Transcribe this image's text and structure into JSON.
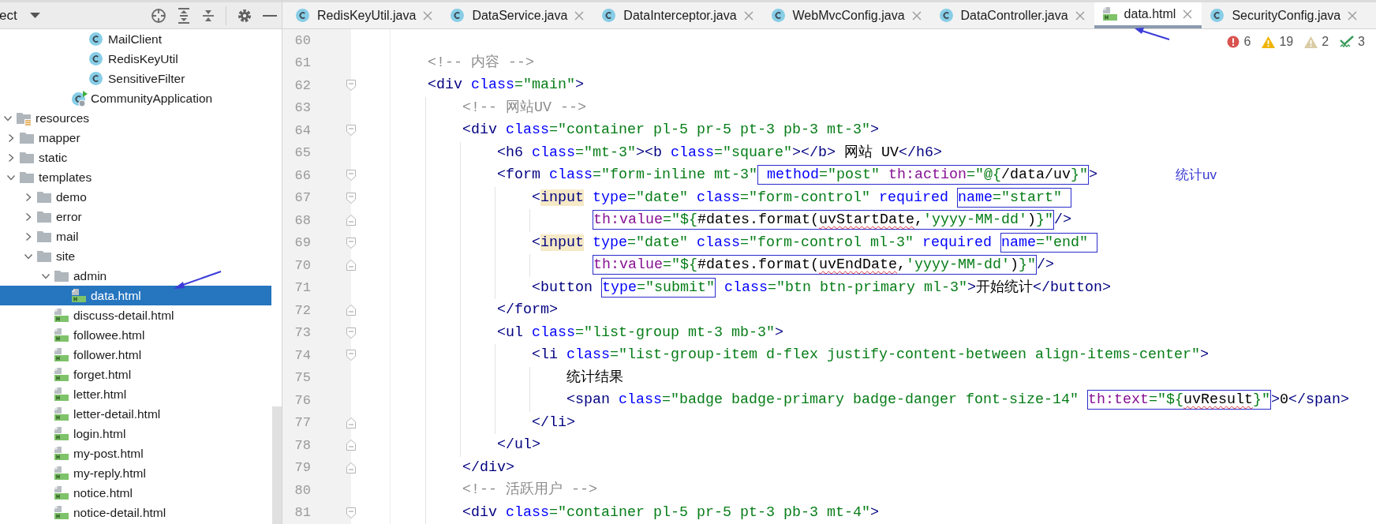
{
  "project_panel": {
    "title": "ect",
    "tree": [
      {
        "children": [
          {
            "children": [
              {
                "children": [
                  {
                    "children": [
                      {
                        "children": [
                          {
                            "label": "MailClient",
                            "kind": "class",
                            "selected": false
                          },
                          {
                            "label": "RedisKeyUtil",
                            "kind": "class",
                            "selected": false
                          },
                          {
                            "label": "SensitiveFilter",
                            "kind": "class",
                            "selected": false
                          }
                        ]
                      },
                      {
                        "label": "CommunityApplication",
                        "kind": "app",
                        "selected": false
                      }
                    ]
                  }
                ]
              }
            ]
          }
        ]
      },
      {
        "label": "resources",
        "kind": "resources",
        "expanded": true,
        "selected": false,
        "children": [
          {
            "label": "mapper",
            "kind": "folder",
            "expanded": false,
            "selected": false
          },
          {
            "label": "static",
            "kind": "folder",
            "expanded": false,
            "selected": false
          },
          {
            "label": "templates",
            "kind": "folder",
            "expanded": true,
            "selected": false,
            "children": [
              {
                "label": "demo",
                "kind": "folder",
                "expanded": false,
                "selected": false
              },
              {
                "label": "error",
                "kind": "folder",
                "expanded": false,
                "selected": false
              },
              {
                "label": "mail",
                "kind": "folder",
                "expanded": false,
                "selected": false
              },
              {
                "label": "site",
                "kind": "folder",
                "expanded": true,
                "selected": false,
                "children": [
                  {
                    "label": "admin",
                    "kind": "folder",
                    "expanded": true,
                    "selected": false,
                    "children": [
                      {
                        "label": "data.html",
                        "kind": "html",
                        "selected": true
                      }
                    ]
                  },
                  {
                    "label": "discuss-detail.html",
                    "kind": "html",
                    "selected": false
                  },
                  {
                    "label": "followee.html",
                    "kind": "html",
                    "selected": false
                  },
                  {
                    "label": "follower.html",
                    "kind": "html",
                    "selected": false
                  },
                  {
                    "label": "forget.html",
                    "kind": "html",
                    "selected": false
                  },
                  {
                    "label": "letter.html",
                    "kind": "html",
                    "selected": false
                  },
                  {
                    "label": "letter-detail.html",
                    "kind": "html",
                    "selected": false
                  },
                  {
                    "label": "login.html",
                    "kind": "html",
                    "selected": false
                  },
                  {
                    "label": "my-post.html",
                    "kind": "html",
                    "selected": false
                  },
                  {
                    "label": "my-reply.html",
                    "kind": "html",
                    "selected": false
                  },
                  {
                    "label": "notice.html",
                    "kind": "html",
                    "selected": false
                  },
                  {
                    "label": "notice-detail.html",
                    "kind": "html",
                    "selected": false
                  }
                ]
              }
            ]
          }
        ]
      }
    ]
  },
  "editor": {
    "tabs": [
      {
        "label": "RedisKeyUtil.java",
        "kind": "class",
        "selected": false
      },
      {
        "label": "DataService.java",
        "kind": "class",
        "selected": false
      },
      {
        "label": "DataInterceptor.java",
        "kind": "class",
        "selected": false
      },
      {
        "label": "WebMvcConfig.java",
        "kind": "class",
        "selected": false
      },
      {
        "label": "DataController.java",
        "kind": "class",
        "selected": false
      },
      {
        "label": "data.html",
        "kind": "html",
        "selected": true
      },
      {
        "label": "SecurityConfig.java",
        "kind": "class",
        "selected": false
      }
    ],
    "inspections": [
      {
        "kind": "error",
        "count": "6"
      },
      {
        "kind": "warning",
        "count": "19"
      },
      {
        "kind": "weak-warning",
        "count": "2"
      },
      {
        "kind": "typo",
        "count": "3"
      }
    ],
    "lines": [
      {
        "number": "60",
        "fold_start": false,
        "fold_end": false
      },
      {
        "number": "61",
        "fold_start": false,
        "fold_end": false,
        "continuation": false,
        "segments": [
          {
            "kind": "plain",
            "tokens": [
              {
                "kind": "comment",
                "text": "<!-- 内容 -->"
              }
            ]
          }
        ]
      },
      {
        "number": "62",
        "fold_start": true,
        "fold_end": false,
        "continuation": false,
        "segments": [
          {
            "kind": "plain",
            "tokens": [
              {
                "kind": "tag",
                "text": "<div"
              },
              {
                "kind": "attr",
                "text": " class"
              },
              {
                "kind": "value",
                "text": "=\"main\""
              },
              {
                "kind": "tag",
                "text": ">"
              }
            ]
          }
        ],
        "children": [
          {
            "number": "63",
            "fold_start": false,
            "fold_end": false,
            "continuation": false,
            "segments": [
              {
                "kind": "plain",
                "tokens": [
                  {
                    "kind": "comment",
                    "text": "<!-- 网站UV -->"
                  }
                ]
              }
            ]
          },
          {
            "number": "64",
            "fold_start": true,
            "fold_end": false,
            "continuation": false,
            "segments": [
              {
                "kind": "plain",
                "tokens": [
                  {
                    "kind": "tag",
                    "text": "<div"
                  },
                  {
                    "kind": "attr",
                    "text": " class"
                  },
                  {
                    "kind": "value",
                    "text": "=\"container pl-5 pr-5 pt-3 pb-3 mt-3\""
                  },
                  {
                    "kind": "tag",
                    "text": ">"
                  }
                ]
              }
            ],
            "children": [
              {
                "number": "65",
                "fold_start": false,
                "fold_end": false,
                "continuation": false,
                "segments": [
                  {
                    "kind": "plain",
                    "tokens": [
                      {
                        "kind": "tag",
                        "text": "<h6"
                      },
                      {
                        "kind": "attr",
                        "text": " class"
                      },
                      {
                        "kind": "value",
                        "text": "=\"mt-3\""
                      },
                      {
                        "kind": "tag",
                        "text": "><b"
                      },
                      {
                        "kind": "attr",
                        "text": " class"
                      },
                      {
                        "kind": "value",
                        "text": "=\"square\""
                      },
                      {
                        "kind": "tag",
                        "text": "></b>"
                      },
                      {
                        "kind": "text",
                        "text": " 网站 UV"
                      },
                      {
                        "kind": "tag",
                        "text": "</h6>"
                      }
                    ]
                  }
                ]
              },
              {
                "number": "66",
                "fold_start": true,
                "fold_end": false,
                "continuation": false,
                "note": "统计uv",
                "segments": [
                  {
                    "kind": "plain",
                    "tokens": [
                      {
                        "kind": "tag",
                        "text": "<form"
                      },
                      {
                        "kind": "attr",
                        "text": " class"
                      },
                      {
                        "kind": "value",
                        "text": "=\"form-inline mt-3\""
                      }
                    ]
                  },
                  {
                    "kind": "boxed",
                    "tokens": [
                      {
                        "kind": "attr",
                        "text": " method"
                      },
                      {
                        "kind": "value",
                        "text": "=\"post\""
                      },
                      {
                        "kind": "ns",
                        "text": " th:action"
                      },
                      {
                        "kind": "value",
                        "text": "=\"@{"
                      },
                      {
                        "kind": "text",
                        "text": "/data/uv"
                      },
                      {
                        "kind": "value",
                        "text": "}\""
                      }
                    ]
                  },
                  {
                    "kind": "plain",
                    "tokens": [
                      {
                        "kind": "tag",
                        "text": ">"
                      }
                    ]
                  }
                ],
                "children": [
                  {
                    "number": "67",
                    "fold_start": true,
                    "fold_end": false,
                    "continuation": false,
                    "segments": [
                      {
                        "kind": "plain",
                        "tokens": [
                          {
                            "kind": "tag",
                            "text": "<"
                          },
                          {
                            "kind": "match",
                            "text": "input"
                          },
                          {
                            "kind": "attr",
                            "text": " type"
                          },
                          {
                            "kind": "value",
                            "text": "=\"date\""
                          },
                          {
                            "kind": "attr",
                            "text": " class"
                          },
                          {
                            "kind": "value",
                            "text": "=\"form-control\""
                          },
                          {
                            "kind": "attr",
                            "text": " required "
                          }
                        ]
                      },
                      {
                        "kind": "boxed",
                        "tokens": [
                          {
                            "kind": "attr",
                            "text": "name"
                          },
                          {
                            "kind": "value",
                            "text": "=\"start\" "
                          }
                        ]
                      }
                    ],
                    "children": [
                      {
                        "number": "68",
                        "fold_start": false,
                        "fold_end": true,
                        "continuation": true,
                        "segments": [
                          {
                            "kind": "boxed",
                            "tokens": [
                              {
                                "kind": "ns",
                                "text": "th:value"
                              },
                              {
                                "kind": "value",
                                "text": "=\"${"
                              },
                              {
                                "kind": "text",
                                "text": "#dates.format("
                              },
                              {
                                "kind": "unresolved",
                                "text": "uvStartDate"
                              },
                              {
                                "kind": "text",
                                "text": ","
                              },
                              {
                                "kind": "value",
                                "text": "'yyyy-MM-dd'"
                              },
                              {
                                "kind": "text",
                                "text": ")"
                              },
                              {
                                "kind": "value",
                                "text": "}\""
                              }
                            ]
                          },
                          {
                            "kind": "plain",
                            "tokens": [
                              {
                                "kind": "tag",
                                "text": "/>"
                              }
                            ]
                          }
                        ]
                      }
                    ]
                  },
                  {
                    "number": "69",
                    "fold_start": true,
                    "fold_end": false,
                    "continuation": false,
                    "segments": [
                      {
                        "kind": "plain",
                        "tokens": [
                          {
                            "kind": "tag",
                            "text": "<"
                          },
                          {
                            "kind": "match",
                            "text": "input"
                          },
                          {
                            "kind": "attr",
                            "text": " type"
                          },
                          {
                            "kind": "value",
                            "text": "=\"date\""
                          },
                          {
                            "kind": "attr",
                            "text": " class"
                          },
                          {
                            "kind": "value",
                            "text": "=\"form-control ml-3\""
                          },
                          {
                            "kind": "attr",
                            "text": " required "
                          }
                        ]
                      },
                      {
                        "kind": "boxed",
                        "tokens": [
                          {
                            "kind": "attr",
                            "text": "name"
                          },
                          {
                            "kind": "value",
                            "text": "=\"end\" "
                          }
                        ]
                      }
                    ],
                    "children": [
                      {
                        "number": "70",
                        "fold_start": false,
                        "fold_end": true,
                        "continuation": true,
                        "segments": [
                          {
                            "kind": "boxed",
                            "tokens": [
                              {
                                "kind": "ns",
                                "text": "th:value"
                              },
                              {
                                "kind": "value",
                                "text": "=\"${"
                              },
                              {
                                "kind": "text",
                                "text": "#dates.format("
                              },
                              {
                                "kind": "unresolved",
                                "text": "uvEndDate"
                              },
                              {
                                "kind": "text",
                                "text": ","
                              },
                              {
                                "kind": "value",
                                "text": "'yyyy-MM-dd'"
                              },
                              {
                                "kind": "text",
                                "text": ")"
                              },
                              {
                                "kind": "value",
                                "text": "}\""
                              }
                            ]
                          },
                          {
                            "kind": "plain",
                            "tokens": [
                              {
                                "kind": "tag",
                                "text": "/>"
                              }
                            ]
                          }
                        ]
                      }
                    ]
                  },
                  {
                    "number": "71",
                    "fold_start": false,
                    "fold_end": false,
                    "continuation": false,
                    "segments": [
                      {
                        "kind": "plain",
                        "tokens": [
                          {
                            "kind": "tag",
                            "text": "<button "
                          }
                        ]
                      },
                      {
                        "kind": "boxed",
                        "tokens": [
                          {
                            "kind": "attr",
                            "text": "type"
                          },
                          {
                            "kind": "value",
                            "text": "=\"submit\""
                          }
                        ]
                      },
                      {
                        "kind": "plain",
                        "tokens": [
                          {
                            "kind": "attr",
                            "text": " class"
                          },
                          {
                            "kind": "value",
                            "text": "=\"btn btn-primary ml-3\""
                          },
                          {
                            "kind": "tag",
                            "text": ">"
                          },
                          {
                            "kind": "text",
                            "text": "开始统计"
                          },
                          {
                            "kind": "tag",
                            "text": "</button>"
                          }
                        ]
                      }
                    ]
                  }
                ]
              },
              {
                "number": "72",
                "fold_start": false,
                "fold_end": true,
                "continuation": false,
                "segments": [
                  {
                    "kind": "plain",
                    "tokens": [
                      {
                        "kind": "tag",
                        "text": "</form>"
                      }
                    ]
                  }
                ]
              },
              {
                "number": "73",
                "fold_start": true,
                "fold_end": false,
                "continuation": false,
                "segments": [
                  {
                    "kind": "plain",
                    "tokens": [
                      {
                        "kind": "tag",
                        "text": "<ul"
                      },
                      {
                        "kind": "attr",
                        "text": " class"
                      },
                      {
                        "kind": "value",
                        "text": "=\"list-group mt-3 mb-3\""
                      },
                      {
                        "kind": "tag",
                        "text": ">"
                      }
                    ]
                  }
                ],
                "children": [
                  {
                    "number": "74",
                    "fold_start": true,
                    "fold_end": false,
                    "continuation": false,
                    "segments": [
                      {
                        "kind": "plain",
                        "tokens": [
                          {
                            "kind": "tag",
                            "text": "<li"
                          },
                          {
                            "kind": "attr",
                            "text": " class"
                          },
                          {
                            "kind": "value",
                            "text": "=\"list-group-item d-flex justify-content-between align-items-center\""
                          },
                          {
                            "kind": "tag",
                            "text": ">"
                          }
                        ]
                      }
                    ],
                    "children": [
                      {
                        "number": "75",
                        "fold_start": false,
                        "fold_end": false,
                        "continuation": false,
                        "segments": [
                          {
                            "kind": "plain",
                            "tokens": [
                              {
                                "kind": "text",
                                "text": "统计结果"
                              }
                            ]
                          }
                        ]
                      },
                      {
                        "number": "76",
                        "fold_start": false,
                        "fold_end": false,
                        "continuation": false,
                        "segments": [
                          {
                            "kind": "plain",
                            "tokens": [
                              {
                                "kind": "tag",
                                "text": "<span"
                              },
                              {
                                "kind": "attr",
                                "text": " class"
                              },
                              {
                                "kind": "value",
                                "text": "=\"badge badge-primary badge-danger font-size-14\" "
                              }
                            ]
                          },
                          {
                            "kind": "boxed",
                            "tokens": [
                              {
                                "kind": "ns",
                                "text": "th:text"
                              },
                              {
                                "kind": "value",
                                "text": "=\"${"
                              },
                              {
                                "kind": "unresolved",
                                "text": "uvResult"
                              },
                              {
                                "kind": "value",
                                "text": "}\""
                              }
                            ]
                          },
                          {
                            "kind": "plain",
                            "tokens": [
                              {
                                "kind": "tag",
                                "text": ">"
                              },
                              {
                                "kind": "text",
                                "text": "0"
                              },
                              {
                                "kind": "tag",
                                "text": "</span>"
                              }
                            ]
                          }
                        ]
                      }
                    ]
                  },
                  {
                    "number": "77",
                    "fold_start": false,
                    "fold_end": true,
                    "continuation": false,
                    "segments": [
                      {
                        "kind": "plain",
                        "tokens": [
                          {
                            "kind": "tag",
                            "text": "</li>"
                          }
                        ]
                      }
                    ]
                  }
                ]
              },
              {
                "number": "78",
                "fold_start": false,
                "fold_end": true,
                "continuation": false,
                "segments": [
                  {
                    "kind": "plain",
                    "tokens": [
                      {
                        "kind": "tag",
                        "text": "</ul>"
                      }
                    ]
                  }
                ]
              }
            ]
          },
          {
            "number": "79",
            "fold_start": false,
            "fold_end": true,
            "continuation": false,
            "segments": [
              {
                "kind": "plain",
                "tokens": [
                  {
                    "kind": "tag",
                    "text": "</div>"
                  }
                ]
              }
            ]
          },
          {
            "number": "80",
            "fold_start": false,
            "fold_end": false,
            "continuation": false,
            "segments": [
              {
                "kind": "plain",
                "tokens": [
                  {
                    "kind": "comment",
                    "text": "<!-- 活跃用户 -->"
                  }
                ]
              }
            ]
          },
          {
            "number": "81",
            "fold_start": true,
            "fold_end": false,
            "continuation": false,
            "segments": [
              {
                "kind": "plain",
                "tokens": [
                  {
                    "kind": "tag",
                    "text": "<div"
                  },
                  {
                    "kind": "attr",
                    "text": " class"
                  },
                  {
                    "kind": "value",
                    "text": "=\"container pl-5 pr-5 pt-3 pb-3 mt-4\""
                  },
                  {
                    "kind": "tag",
                    "text": ">"
                  }
                ]
              }
            ]
          }
        ]
      }
    ]
  }
}
